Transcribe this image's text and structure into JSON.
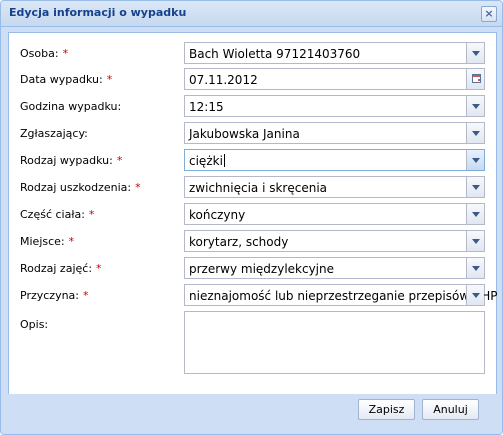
{
  "window": {
    "title": "Edycja informacji o wypadku"
  },
  "form": {
    "required_mark": "*",
    "fields": [
      {
        "label": "Osoba:",
        "required": true,
        "value": "Bach Wioletta 97121403760",
        "type": "combo"
      },
      {
        "label": "Data wypadku:",
        "required": true,
        "value": "07.11.2012",
        "type": "date"
      },
      {
        "label": "Godzina wypadku:",
        "required": false,
        "value": "12:15",
        "type": "combo"
      },
      {
        "label": "Zgłaszający:",
        "required": false,
        "value": "Jakubowska Janina",
        "type": "combo"
      },
      {
        "label": "Rodzaj wypadku:",
        "required": true,
        "value": "ciężki",
        "type": "combo"
      },
      {
        "label": "Rodzaj uszkodzenia:",
        "required": true,
        "value": "zwichnięcia i skręcenia",
        "type": "combo"
      },
      {
        "label": "Część ciała:",
        "required": true,
        "value": "kończyny",
        "type": "combo"
      },
      {
        "label": "Miejsce:",
        "required": true,
        "value": "korytarz, schody",
        "type": "combo"
      },
      {
        "label": "Rodzaj zajęć:",
        "required": true,
        "value": "przerwy międzylekcyjne",
        "type": "combo"
      },
      {
        "label": "Przyczyna:",
        "required": true,
        "value": "nieznajomość lub nieprzestrzeganie przepisów BHP",
        "type": "combo"
      }
    ],
    "opis_label": "Opis:",
    "opis_value": ""
  },
  "footer": {
    "save_label": "Zapisz",
    "cancel_label": "Anuluj"
  },
  "colors": {
    "border": "#99bbe8",
    "title_text": "#15428b",
    "required": "#cc0000",
    "footer_bg": "#cedff5"
  }
}
